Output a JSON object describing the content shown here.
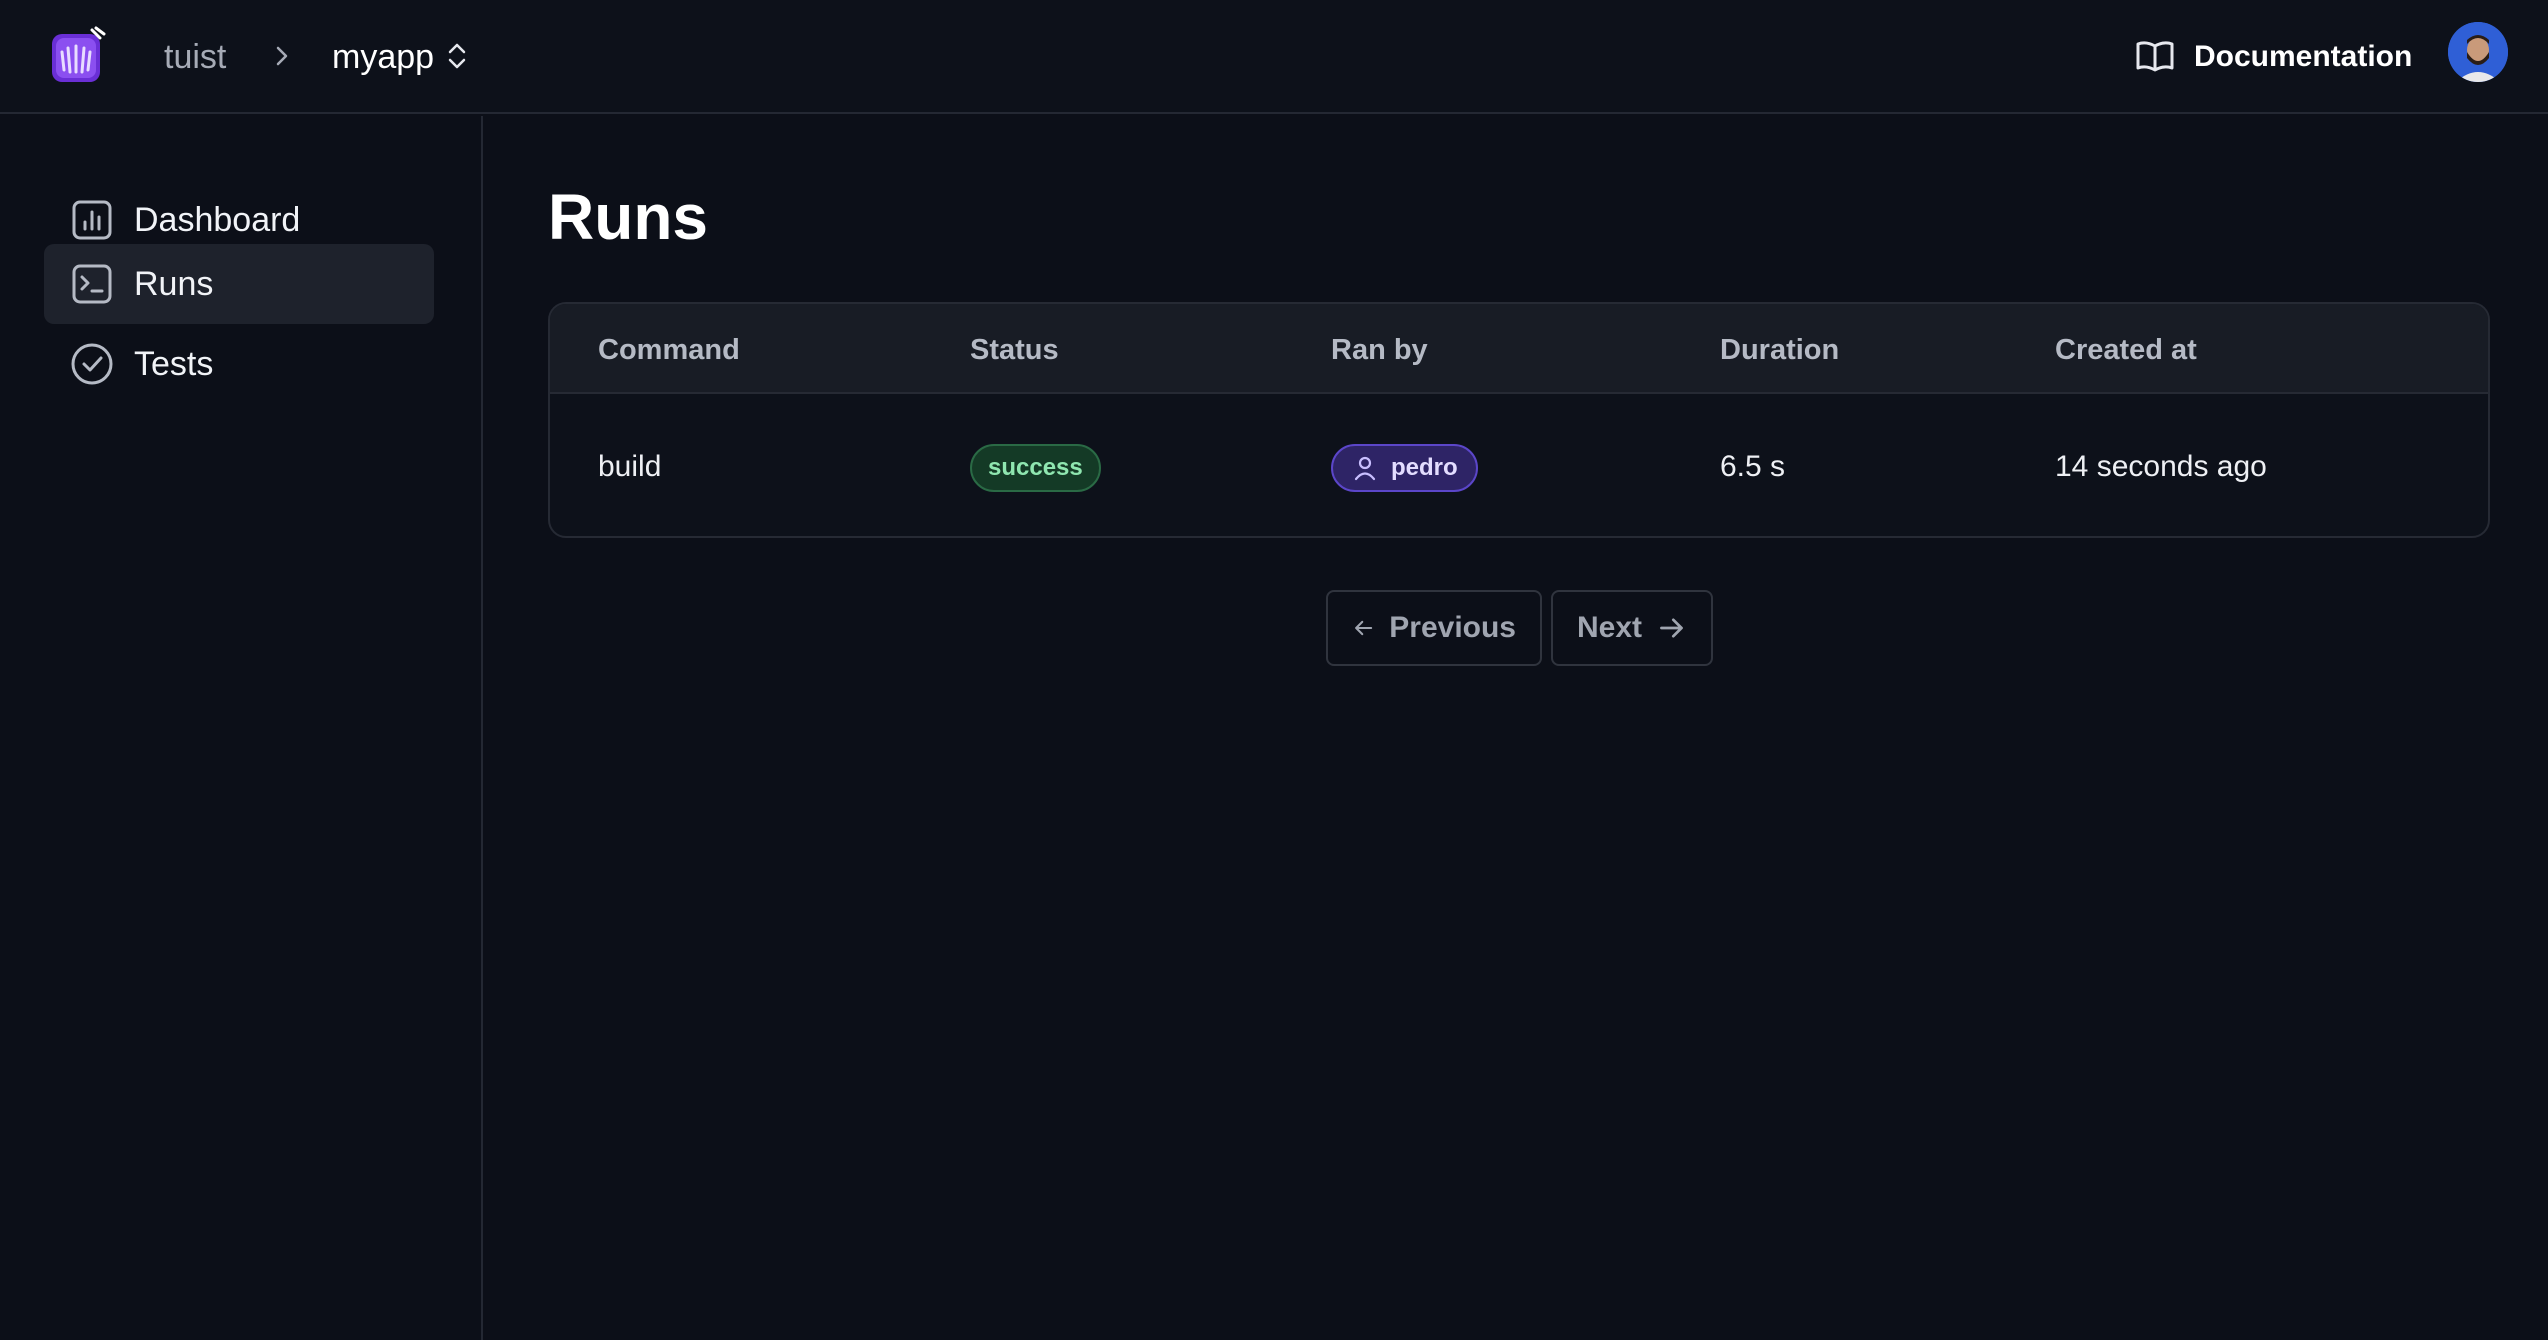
{
  "header": {
    "org": "tuist",
    "project": "myapp",
    "docs_label": "Documentation"
  },
  "sidebar": {
    "items": [
      {
        "label": "Dashboard",
        "icon": "chart-icon"
      },
      {
        "label": "Runs",
        "icon": "terminal-icon",
        "active": true
      },
      {
        "label": "Tests",
        "icon": "check-circle-icon"
      }
    ]
  },
  "main": {
    "title": "Runs",
    "table": {
      "columns": [
        "Command",
        "Status",
        "Ran by",
        "Duration",
        "Created at"
      ],
      "rows": [
        {
          "command": "build",
          "status": "success",
          "ran_by": "pedro",
          "duration": "6.5 s",
          "created_at": "14 seconds ago"
        }
      ]
    },
    "pagination": {
      "previous": "Previous",
      "next": "Next"
    }
  },
  "colors": {
    "background": "#0c0f18",
    "active_nav": "#1e222c",
    "success_badge": "#143a26",
    "user_badge": "#2e2466",
    "logo_purple": "#7b3fe4"
  }
}
